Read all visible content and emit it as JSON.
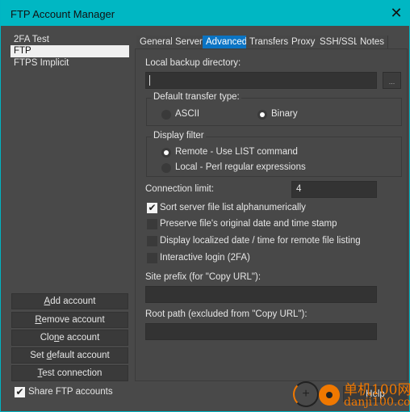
{
  "window": {
    "title": "FTP Account Manager",
    "close_icon": "close-icon"
  },
  "accounts": [
    {
      "label": "2FA Test",
      "selected": false
    },
    {
      "label": "FTP",
      "selected": true
    },
    {
      "label": "FTPS Implicit",
      "selected": false
    }
  ],
  "buttons": {
    "add": "Add account",
    "remove": "Remove account",
    "clone": "Clone account",
    "set_default": "Set default account",
    "test": "Test connection",
    "help": "Help",
    "browse": "..."
  },
  "share": {
    "label": "Share FTP accounts",
    "checked": true
  },
  "tabs": [
    {
      "label": "General"
    },
    {
      "label": "Server"
    },
    {
      "label": "Advanced",
      "active": true
    },
    {
      "label": "Transfers"
    },
    {
      "label": "Proxy"
    },
    {
      "label": "SSH/SSL"
    },
    {
      "label": "Notes"
    }
  ],
  "advanced": {
    "local_backup_label": "Local backup directory:",
    "local_backup_value": "",
    "transfer_type": {
      "legend": "Default transfer type:",
      "ascii": "ASCII",
      "binary": "Binary",
      "selected": "Binary"
    },
    "display_filter": {
      "legend": "Display filter",
      "remote": "Remote - Use LIST command",
      "local": "Local - Perl regular expressions",
      "selected": "Remote"
    },
    "connection_limit_label": "Connection limit:",
    "connection_limit": "4",
    "options": [
      {
        "label": "Sort server file list alphanumerically",
        "checked": true
      },
      {
        "label": "Preserve file's original date and time stamp",
        "checked": false
      },
      {
        "label": "Display localized date / time for remote file listing",
        "checked": false
      },
      {
        "label": "Interactive login (2FA)",
        "checked": false
      }
    ],
    "site_prefix_label": "Site prefix (for \"Copy URL\"):",
    "site_prefix": "",
    "root_path_label": "Root path (excluded from \"Copy URL\"):",
    "root_path": ""
  },
  "watermark": {
    "cn": "单机100网",
    "url": "danji100.com"
  },
  "accent": "#0b74c4",
  "titlebar": "#00b7c3"
}
